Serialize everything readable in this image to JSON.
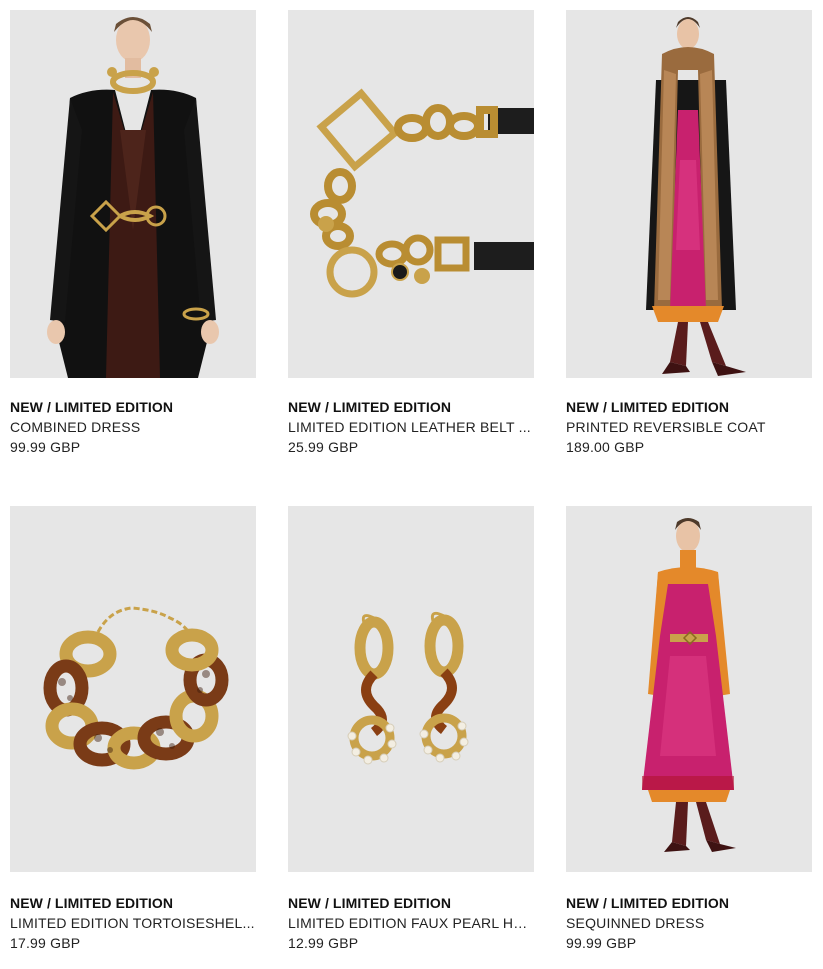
{
  "products": [
    {
      "tag": "NEW / LIMITED EDITION",
      "name": "COMBINED DRESS",
      "price": "99.99 GBP",
      "image_icon": "model-black-coat-chain-belt"
    },
    {
      "tag": "NEW / LIMITED EDITION",
      "name": "LIMITED EDITION LEATHER BELT ...",
      "price": "25.99 GBP",
      "image_icon": "gold-chain-leather-belt"
    },
    {
      "tag": "NEW / LIMITED EDITION",
      "name": "PRINTED REVERSIBLE COAT",
      "price": "189.00 GBP",
      "image_icon": "model-fur-coat-sequin-dress"
    },
    {
      "tag": "NEW / LIMITED EDITION",
      "name": "LIMITED EDITION TORTOISESHEL...",
      "price": "17.99 GBP",
      "image_icon": "tortoiseshell-chain-necklace"
    },
    {
      "tag": "NEW / LIMITED EDITION",
      "name": "LIMITED EDITION FAUX PEARL HO...",
      "price": "12.99 GBP",
      "image_icon": "faux-pearl-hoop-earrings"
    },
    {
      "tag": "NEW / LIMITED EDITION",
      "name": "SEQUINNED DRESS",
      "price": "99.99 GBP",
      "image_icon": "model-pink-sequin-dress"
    }
  ],
  "colors": {
    "image_background": "#e6e6e6",
    "text": "#111111",
    "gold": "#c9a24a",
    "magenta": "#c8216e",
    "orange": "#e4892a"
  }
}
